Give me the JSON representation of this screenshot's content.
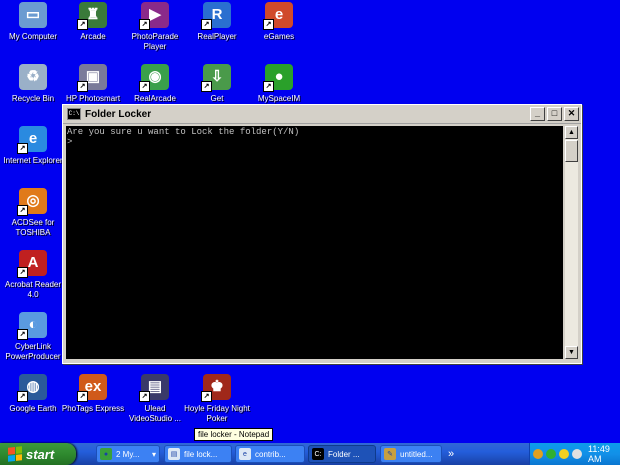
{
  "desktop": {
    "background_color": "#0000f0",
    "icons": [
      {
        "label": "My Computer",
        "icon": "my-computer-icon",
        "color": "#6b9bd1"
      },
      {
        "label": "Arcade",
        "icon": "arcade-icon",
        "color": "#3a7a3a"
      },
      {
        "label": "PhotoParade Player",
        "icon": "photoparade-icon",
        "color": "#8a2a8a"
      },
      {
        "label": "RealPlayer",
        "icon": "realplayer-icon",
        "color": "#2a6fd0"
      },
      {
        "label": "eGames",
        "icon": "egames-icon",
        "color": "#d04a2a"
      },
      {
        "label": "Recycle Bin",
        "icon": "recycle-bin-icon",
        "color": "#9ab0c8"
      },
      {
        "label": "HP Photosmart",
        "icon": "hp-photosmart-icon",
        "color": "#7a7a9a"
      },
      {
        "label": "RealArcade",
        "icon": "realarcade-icon",
        "color": "#3aa04a"
      },
      {
        "label": "Get",
        "icon": "get-icon",
        "color": "#4a9a4a"
      },
      {
        "label": "MySpaceIM",
        "icon": "myspaceim-icon",
        "color": "#2aa02a"
      },
      {
        "label": "Internet Explorer",
        "icon": "internet-explorer-icon",
        "color": "#2a8ae0"
      },
      {
        "label": "ACDSee for TOSHIBA",
        "icon": "acdsee-icon",
        "color": "#e07a1a"
      },
      {
        "label": "Acrobat Reader 4.0",
        "icon": "acrobat-reader-icon",
        "color": "#c02020"
      },
      {
        "label": "CyberLink PowerProducer",
        "icon": "cyberlink-icon",
        "color": "#5a9ae0"
      },
      {
        "label": "Google Earth",
        "icon": "google-earth-icon",
        "color": "#2a5a9a"
      },
      {
        "label": "PhoTags Express",
        "icon": "photags-icon",
        "color": "#d05a1a"
      },
      {
        "label": "Ulead VideoStudio ...",
        "icon": "ulead-icon",
        "color": "#3a3a6a"
      },
      {
        "label": "Hoyle Friday Night Poker",
        "icon": "hoyle-poker-icon",
        "color": "#a0281a"
      }
    ]
  },
  "console": {
    "title": "Folder Locker",
    "system_icon_text": "C:\\",
    "lines": [
      "Are you sure u want to Lock the folder(Y/N)",
      ">"
    ],
    "minimize": "_",
    "maximize": "□",
    "close": "✕",
    "scroll_up": "▲",
    "scroll_down": "▼"
  },
  "tooltip": "file locker - Notepad",
  "taskbar": {
    "start_label": "start",
    "tasks": [
      {
        "label": "2 My...",
        "icon": "msn-messenger-icon",
        "color": "#3aa03a",
        "active": false,
        "menu": "▾"
      },
      {
        "label": "file lock...",
        "icon": "notepad-icon",
        "color": "#dde8f5",
        "active": false
      },
      {
        "label": "contrib...",
        "icon": "internet-explorer-icon",
        "color": "#dde8f5",
        "active": false
      },
      {
        "label": "Folder ...",
        "icon": "cmd-icon",
        "color": "#000000",
        "active": true
      },
      {
        "label": "untitled...",
        "icon": "paint-icon",
        "color": "#c8a040",
        "active": false
      }
    ],
    "overflow": "»",
    "clock": "11:49 AM",
    "tray_icons": [
      {
        "icon": "network-icon",
        "color": "#e0a020"
      },
      {
        "icon": "messenger-tray-icon",
        "color": "#30b030"
      },
      {
        "icon": "norton-tray-icon",
        "color": "#f0d020"
      },
      {
        "icon": "volume-tray-icon",
        "color": "#e0e0e0"
      }
    ]
  }
}
